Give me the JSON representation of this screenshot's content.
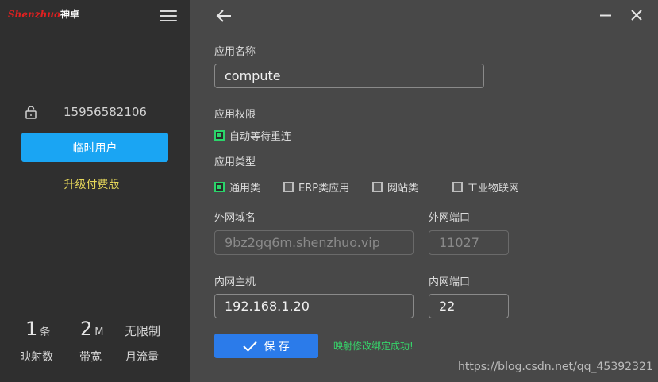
{
  "sidebar": {
    "logo_text": "Shenzhuo",
    "logo_cn": "神卓",
    "account_phone": "15956582106",
    "temp_user_label": "临时用户",
    "upgrade_label": "升级付费版",
    "stats": [
      {
        "value": "1",
        "unit": "条",
        "label": "映射数"
      },
      {
        "value": "2",
        "unit": "M",
        "label": "带宽"
      },
      {
        "value": "无限制",
        "unit": "",
        "label": "月流量"
      }
    ]
  },
  "form": {
    "app_name_label": "应用名称",
    "app_name_value": "compute",
    "permission_label": "应用权限",
    "auto_reconnect_label": "自动等待重连",
    "type_label": "应用类型",
    "types": [
      {
        "label": "通用类",
        "checked": true
      },
      {
        "label": "ERP类应用",
        "checked": false
      },
      {
        "label": "网站类",
        "checked": false
      },
      {
        "label": "工业物联网",
        "checked": false
      }
    ],
    "external_domain_label": "外网域名",
    "external_domain_value": "9bz2gq6m.shenzhuo.vip",
    "external_port_label": "外网端口",
    "external_port_value": "11027",
    "internal_host_label": "内网主机",
    "internal_host_value": "192.168.1.20",
    "internal_port_label": "内网端口",
    "internal_port_value": "22",
    "save_label": "保 存",
    "success_message": "映射修改绑定成功!"
  },
  "watermark": "https://blog.csdn.net/qq_45392321",
  "colors": {
    "sidebar_bg": "#2f2f2f",
    "main_bg": "#484848",
    "accent_blue": "#1aa5f3",
    "save_blue": "#2b7bea",
    "upgrade_yellow": "#e6d75a",
    "success_green": "#36d46a"
  }
}
